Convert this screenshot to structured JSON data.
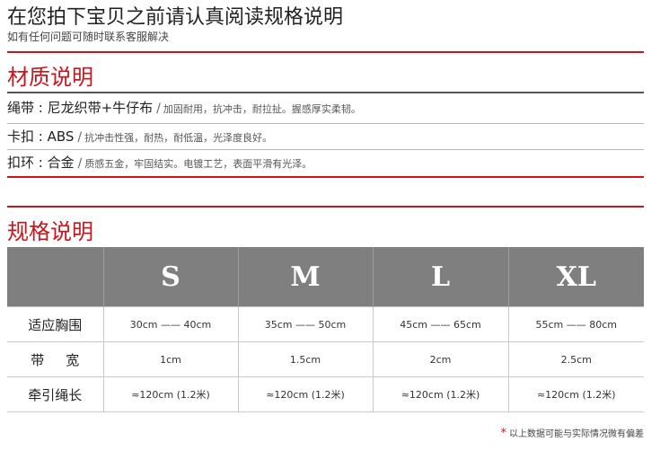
{
  "header": {
    "title": "在您拍下宝贝之前请认真阅读规格说明",
    "subtitle": "如有任何问题可随时联系客服解决"
  },
  "materials": {
    "heading": "材质说明",
    "separator": "/",
    "items": [
      {
        "name": "绳带 : 尼龙织带+牛仔布",
        "desc": "加固耐用，抗冲击，耐拉扯。握感厚实柔韧。"
      },
      {
        "name": "卡扣 : ABS",
        "desc": "抗冲击性强，耐热，耐低温，光泽度良好。"
      },
      {
        "name": "扣环 : 合金",
        "desc": "质感五金，牢固结实。电镀工艺，表面平滑有光泽。"
      }
    ]
  },
  "specs": {
    "heading": "规格说明",
    "sizes": [
      "S",
      "M",
      "L",
      "XL"
    ],
    "rows": [
      {
        "label": "适应胸围",
        "values": [
          "30cm —— 40cm",
          "35cm —— 50cm",
          "45cm —— 65cm",
          "55cm —— 80cm"
        ]
      },
      {
        "label": "带宽",
        "values": [
          "1cm",
          "1.5cm",
          "2cm",
          "2.5cm"
        ]
      },
      {
        "label": "牵引绳长",
        "values": [
          "≈120cm (1.2米)",
          "≈120cm (1.2米)",
          "≈120cm (1.2米)",
          "≈120cm (1.2米)"
        ]
      }
    ],
    "footnote": "以上数据可能与实际情况微有偏差"
  }
}
